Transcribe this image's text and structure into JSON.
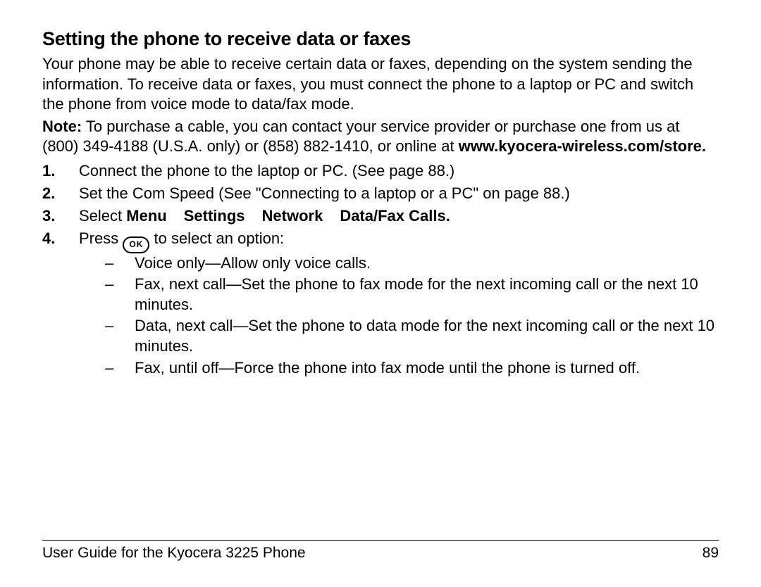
{
  "heading": "Setting the phone to receive data or faxes",
  "intro": "Your phone may be able to receive certain data or faxes, depending on the system sending the information. To receive data or faxes, you must connect the phone to a laptop or PC and switch the phone from voice mode to data/fax mode.",
  "note_label": "Note:",
  "note_body": " To purchase a cable, you can contact your service provider or purchase one from us at (800) 349-4188 (U.S.A. only) or (858) 882-1410, or online at ",
  "note_url": "www.kyocera-wireless.com/store.",
  "steps": {
    "s1": "Connect the phone to the laptop or PC. (See page 88.)",
    "s2": "Set the Com Speed (See \"Connecting to a laptop or a PC\" on page 88.)",
    "s3_prefix": "Select ",
    "s3_menu": "Menu",
    "s3_settings": "Settings",
    "s3_network": "Network",
    "s3_datafax": "Data/Fax Calls.",
    "s4_prefix": "Press ",
    "s4_ok_label": "OK",
    "s4_suffix": " to select an option:"
  },
  "options": {
    "o1_bold": "Voice only",
    "o1_rest": "—Allow only voice calls.",
    "o2_bold": "Fax, next call",
    "o2_rest": "—Set the phone to fax mode for the next incoming call or the next 10 minutes.",
    "o3": "Data, next call—Set the phone to data mode for the next incoming call or the next 10 minutes.",
    "o4_bold": "Fax, until off",
    "o4_rest": "—Force the phone into fax mode until the phone is turned off."
  },
  "footer": {
    "left": "User Guide for the Kyocera 3225 Phone",
    "right": "89"
  }
}
